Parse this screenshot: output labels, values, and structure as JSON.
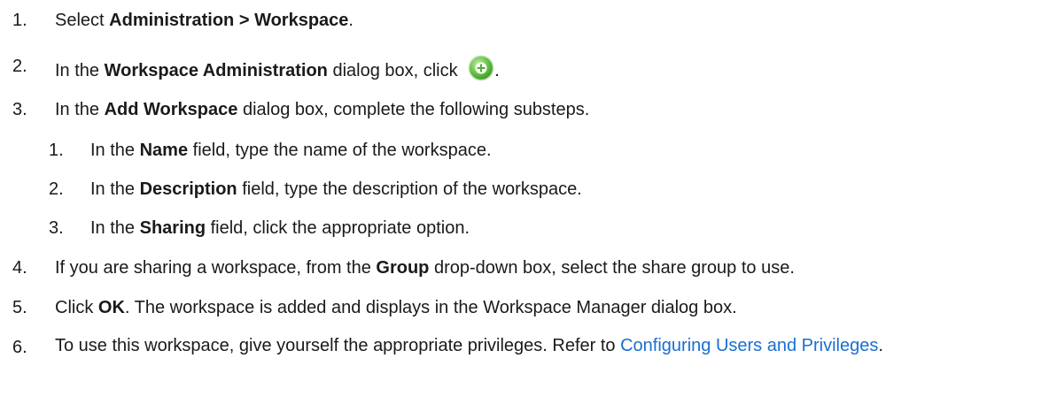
{
  "steps": [
    {
      "num": "1.",
      "pre": "Select ",
      "b1": "Administration > Workspace",
      "post": "."
    },
    {
      "num": "2.",
      "pre": "In the ",
      "b1": "Workspace Administration",
      "post": " dialog box, click ",
      "end": ".",
      "icon": "add-circle-icon"
    },
    {
      "num": "3.",
      "pre": "In the ",
      "b1": "Add Workspace",
      "post": " dialog box, complete the following substeps."
    },
    {
      "num": "4.",
      "pre": "If you are sharing a workspace, from the ",
      "b1": "Group",
      "post": " drop-down box, select the share group to use."
    },
    {
      "num": "5.",
      "pre": "Click ",
      "b1": "OK",
      "post": ". The workspace is added and displays in the Workspace Manager dialog box."
    },
    {
      "num": "6.",
      "pre": "To use this workspace, give yourself the appropriate privileges. Refer to ",
      "link": "Configuring Users and Privileges",
      "post": "."
    }
  ],
  "substeps": [
    {
      "num": "1.",
      "pre": "In the ",
      "b1": "Name",
      "post": " field, type the name of the workspace."
    },
    {
      "num": "2.",
      "pre": "In the ",
      "b1": "Description",
      "post": " field, type the description of the workspace."
    },
    {
      "num": "3.",
      "pre": "In the ",
      "b1": "Sharing",
      "post": " field, click the appropriate option."
    }
  ],
  "colors": {
    "link": "#1a6fd1",
    "icon_green": "#5bbf3a"
  }
}
